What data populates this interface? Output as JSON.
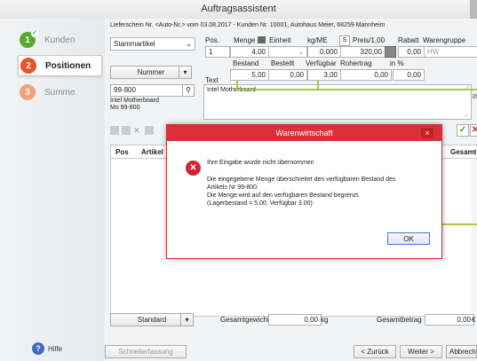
{
  "window": {
    "title": "Auftragsassistent"
  },
  "steps": [
    {
      "num": "1",
      "label": "Kunden",
      "color": "#5aa832",
      "done": true
    },
    {
      "num": "2",
      "label": "Positionen",
      "color": "#e8542a",
      "done": false
    },
    {
      "num": "3",
      "label": "Summe",
      "color": "#f1a27a",
      "done": false
    }
  ],
  "help": {
    "label": "Hilfe"
  },
  "header": {
    "info": "Lieferschein Nr. <Auto-Nr.> vom 03.08.2017 - Kunden Nr. 10001, Autohaus Meier, 68259 Mannheim"
  },
  "form": {
    "stammartikel": "Stammartikel",
    "col_pos": "Pos.",
    "col_menge": "Menge",
    "col_einheit": "Einheit",
    "col_kgme": "kg/ME",
    "col_s": "S",
    "col_preis": "Preis/1,00",
    "col_rabatt": "Rabatt",
    "col_warengruppe": "Warengruppe",
    "pos": "1",
    "menge": "4,00",
    "kgme": "0,000",
    "preis": "320,00",
    "rabatt": "0,00",
    "warengruppe": "HW",
    "col_bestand": "Bestand",
    "col_bestellt": "Bestellt",
    "col_verfuegbar": "Verfügbar",
    "col_rohertrag": "Rohertrag",
    "col_inpct": "in %",
    "bestand": "5,00",
    "bestellt": "0,00",
    "verfuegbar": "3,00",
    "rohertrag": "0,00",
    "inpct": "0,00",
    "nummer_btn": "Nummer",
    "text_label": "Text",
    "artikel_nr": "99-800",
    "artikel_desc1": "Intel Motherboard",
    "artikel_desc2": "Mo 99-800",
    "text_value": "Intel Motherboard"
  },
  "grid": {
    "col_pos": "Pos",
    "col_artikel": "Artikel",
    "col_gesamt": "Gesamt"
  },
  "dialog": {
    "title": "Warenwirtschaft",
    "close": "×",
    "line1": "Ihre Eingabe wurde nicht übernommen",
    "line2": "Die eingegebene Menge überschreitet den verfügbaren Bestand des",
    "line3": "Artikels Nr 99-800.",
    "line4": "Die Menge wird auf den verfügbaren Bestand begrenzt.",
    "line5": "(Lagerbestand = 5.00, Verfügbar 3.00)",
    "ok": "OK"
  },
  "footer": {
    "standard": "Standard",
    "gesamtgewicht_label": "Gesamtgewicht",
    "gesamtgewicht": "0,00",
    "gesamtgewicht_unit": "kg",
    "gesamtbetrag_label": "Gesamtbetrag",
    "gesamtbetrag": "0,00",
    "gesamtbetrag_unit": "€",
    "schnellerfassung": "Schnellerfassung",
    "zurueck": "< Zurück",
    "weiter": "Weiter >",
    "abbrechen": "Abbreche"
  },
  "colors": {
    "accent_green": "#a9c93a",
    "dialog_red": "#d93039"
  }
}
